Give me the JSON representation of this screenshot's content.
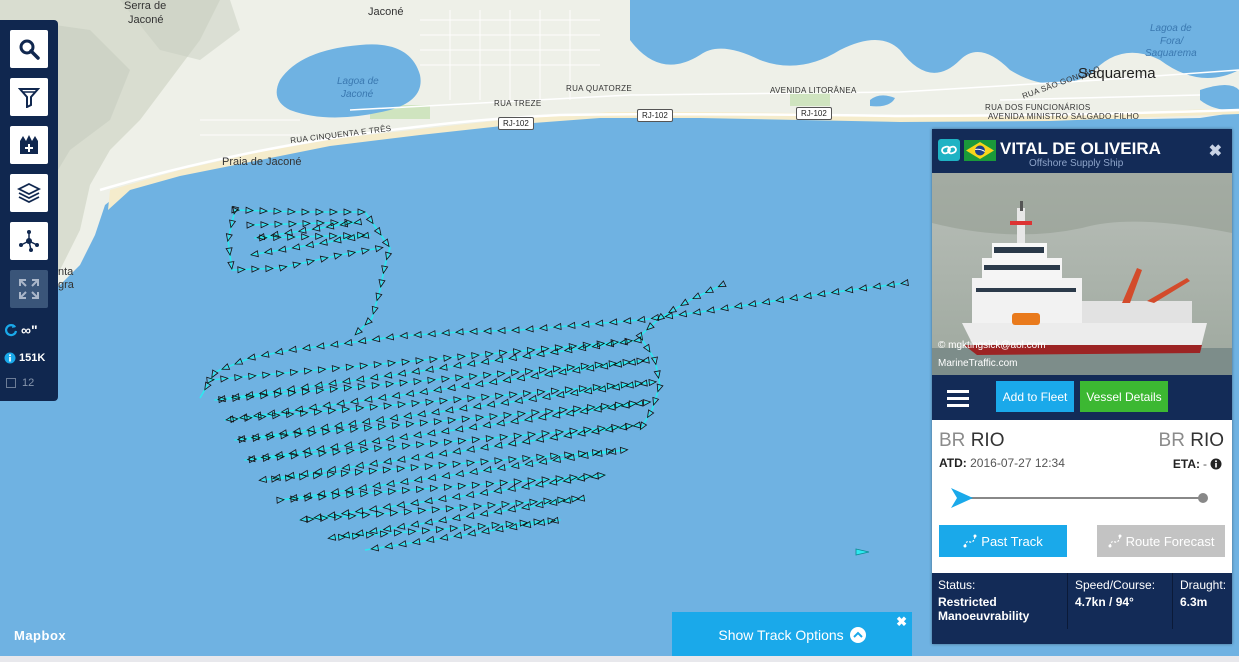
{
  "map": {
    "labels": {
      "serra": "Serra de",
      "serra2": "Jaconé",
      "jacone": "Jaconé",
      "lagoa_jacone": "Lagoa de",
      "lagoa_jacone2": "Jaconé",
      "praia": "Praia de Jaconé",
      "rua_treze": "RUA TREZE",
      "rua_quatorze": "RUA QUATORZE",
      "rua_cinquenta": "RUA CINQUENTA E TRÊS",
      "avenida_litoranea": "AVENIDA LITORÂNEA",
      "rua_sao_goncalo": "RUA SÃO GONÇALO",
      "rua_funcionarios": "RUA DOS FUNCIONÁRIOS",
      "avenida_ministro": "AVENIDA MINISTRO SALGADO FILHO",
      "saquarema": "Saquarema",
      "lagoa_fora": "Lagoa de",
      "lagoa_fora2": "Fora/",
      "lagoa_fora3": "Saquarema",
      "nta": "nta",
      "gra": "gra"
    },
    "shields": [
      "RJ-102",
      "RJ-102",
      "RJ-102"
    ],
    "attribution": "Mapbox"
  },
  "toolbar": {
    "buttons": [
      "search-icon",
      "filter-icon",
      "fleet-icon",
      "layers-icon",
      "network-icon",
      "fullscreen-icon"
    ],
    "time_label": "∞\"",
    "vessels_count": "151K",
    "selected_count": "12"
  },
  "vessel": {
    "name": "VITAL DE OLIVEIRA",
    "type": "Offshore Supply Ship",
    "flag": "Brazil",
    "photo_credit": "© mgktingsick@aol.com",
    "photo_watermark": "MarineTraffic.com",
    "menu_icon": "hamburger-icon",
    "add_to_fleet": "Add to Fleet",
    "vessel_details": "Vessel Details",
    "departure": {
      "cc": "BR",
      "port": "RIO"
    },
    "arrival": {
      "cc": "BR",
      "port": "RIO"
    },
    "atd_label": "ATD:",
    "atd_value": "2016-07-27 12:34",
    "eta_label": "ETA:",
    "eta_value": "-",
    "progress": 0,
    "past_track": "Past Track",
    "route_forecast": "Route Forecast",
    "status_label": "Status:",
    "status_value": "Restricted Manoeuvrability",
    "speed_label": "Speed/Course:",
    "speed_value": "4.7kn / 94°",
    "draught_label": "Draught:",
    "draught_value": "6.3m"
  },
  "track_options": {
    "label": "Show Track Options",
    "close": "✖"
  },
  "colors": {
    "sea": "#6fb2e2",
    "panel_navy": "#132b57",
    "track_cyan": "#2ee8f0",
    "accent_blue": "#1aa9ea",
    "green": "#3cb832"
  }
}
